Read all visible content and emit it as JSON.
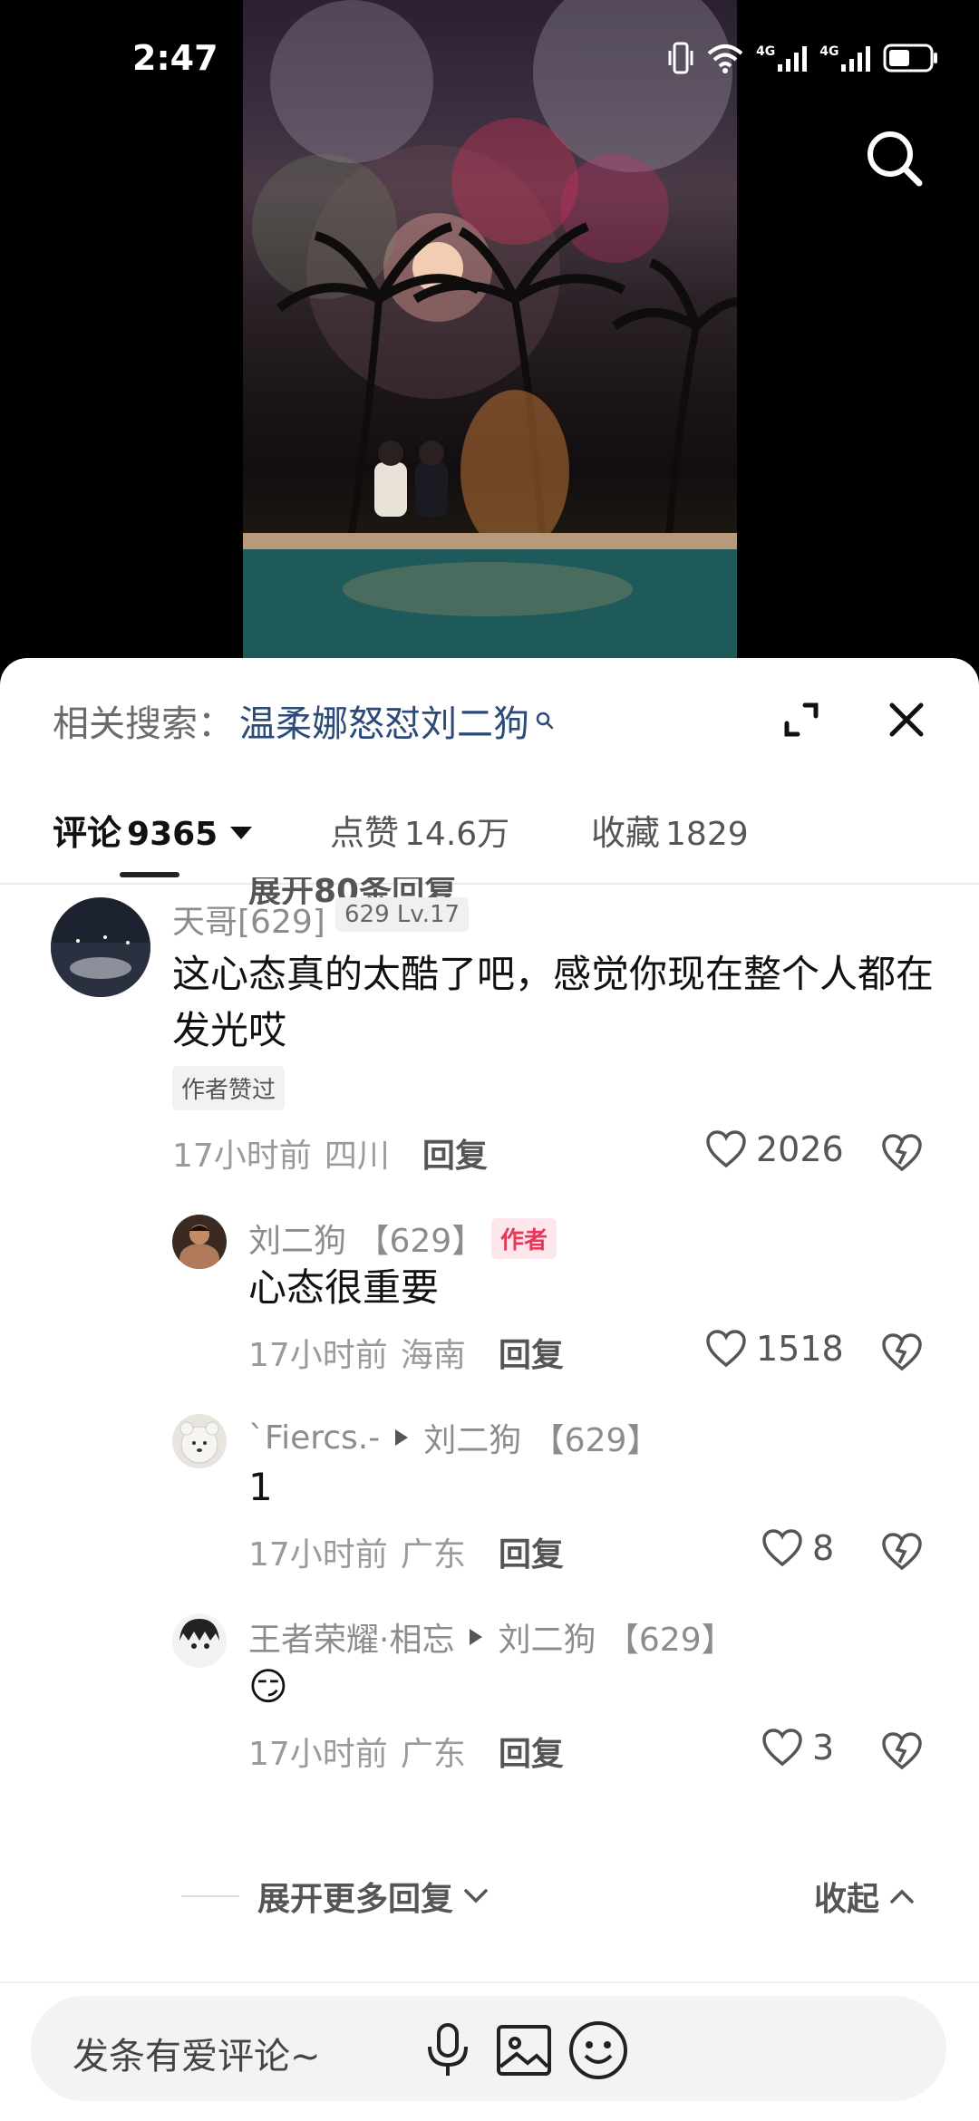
{
  "status_bar": {
    "time": "2:47",
    "net1": "4G",
    "net2": "4G"
  },
  "related_search": {
    "prefix": "相关搜索：",
    "query": "温柔娜怒怼刘二狗"
  },
  "tabs": [
    {
      "label": "评论",
      "count": "9365"
    },
    {
      "label": "点赞",
      "count": "14.6万"
    },
    {
      "label": "收藏",
      "count": "1829"
    }
  ],
  "collapsed_replies_top": "展开80条回复",
  "comment": {
    "username": "天哥[629]",
    "level_badge": "629 Lv.17",
    "text": "这心态真的太酷了吧，感觉你现在整个人都在发光哎",
    "author_liked": "作者赞过",
    "time": "17小时前",
    "location": "四川",
    "reply_label": "回复",
    "likes": "2026"
  },
  "replies": [
    {
      "username": "刘二狗 【629】",
      "badge": "作者",
      "text": "心态很重要",
      "time": "17小时前",
      "location": "海南",
      "reply_label": "回复",
      "likes": "1518"
    },
    {
      "username": "`Fiercs.-",
      "reply_to": "刘二狗 【629】",
      "text": "1",
      "time": "17小时前",
      "location": "广东",
      "reply_label": "回复",
      "likes": "8"
    },
    {
      "username": "王者荣耀·相忘",
      "reply_to": "刘二狗 【629】",
      "text": "😏",
      "time": "17小时前",
      "location": "广东",
      "reply_label": "回复",
      "likes": "3"
    }
  ],
  "expand_more": "展开更多回复",
  "collapse": "收起",
  "input": {
    "placeholder": "发条有爱评论~"
  },
  "colors": {
    "author_badge": "#e8385a",
    "related_query": "#2b4a78"
  }
}
